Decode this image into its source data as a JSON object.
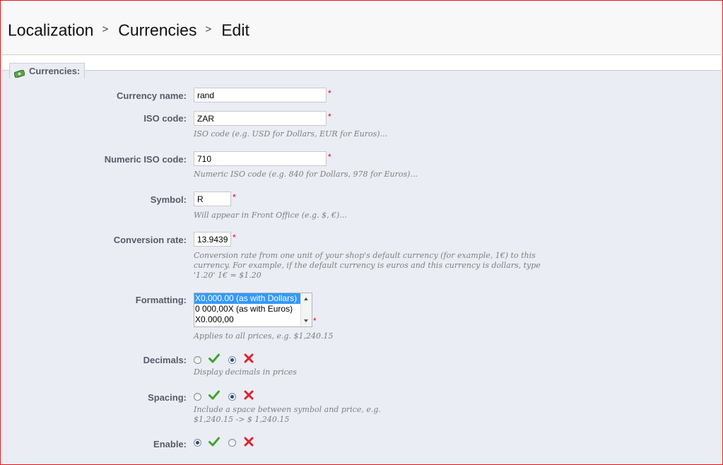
{
  "breadcrumb": {
    "items": [
      "Localization",
      "Currencies",
      "Edit"
    ],
    "separator": ">"
  },
  "fieldset": {
    "legend": "Currencies:",
    "icon": "money-icon"
  },
  "form": {
    "currency_name": {
      "label": "Currency name:",
      "value": "rand",
      "required": "*"
    },
    "iso_code": {
      "label": "ISO code:",
      "value": "ZAR",
      "required": "*",
      "hint": "ISO code (e.g. USD for Dollars, EUR for Euros)..."
    },
    "numeric_iso": {
      "label": "Numeric ISO code:",
      "value": "710",
      "required": "*",
      "hint": "Numeric ISO code (e.g. 840 for Dollars, 978 for Euros)..."
    },
    "symbol": {
      "label": "Symbol:",
      "value": "R",
      "required": "*",
      "hint": "Will appear in Front Office (e.g. $, €)..."
    },
    "conversion_rate": {
      "label": "Conversion rate:",
      "value": "13.9439",
      "required": "*",
      "hint_lines": [
        "Conversion rate from one unit of your shop's default currency (for example, 1€) to this",
        "currency. For example, if the default currency is euros and this currency is dollars, type",
        "'1.20' 1€ = $1.20"
      ]
    },
    "formatting": {
      "label": "Formatting:",
      "required": "*",
      "options": [
        "X0,000.00 (as with Dollars)",
        "0 000,00X (as with Euros)",
        "X0.000,00"
      ],
      "selected_index": 0,
      "hint": "Applies to all prices, e.g. $1,240.15"
    },
    "decimals": {
      "label": "Decimals:",
      "selected": "no",
      "hint": "Display decimals in prices"
    },
    "spacing": {
      "label": "Spacing:",
      "selected": "no",
      "hint_lines": [
        "Include a space between symbol and price, e.g.",
        "$1,240.15 -> $ 1,240.15"
      ]
    },
    "enable": {
      "label": "Enable:",
      "selected": "yes"
    }
  },
  "colors": {
    "accent_border": "#e0141a",
    "label": "#585a69",
    "panel_bg": "#ebedf4",
    "required": "#ee0000"
  }
}
